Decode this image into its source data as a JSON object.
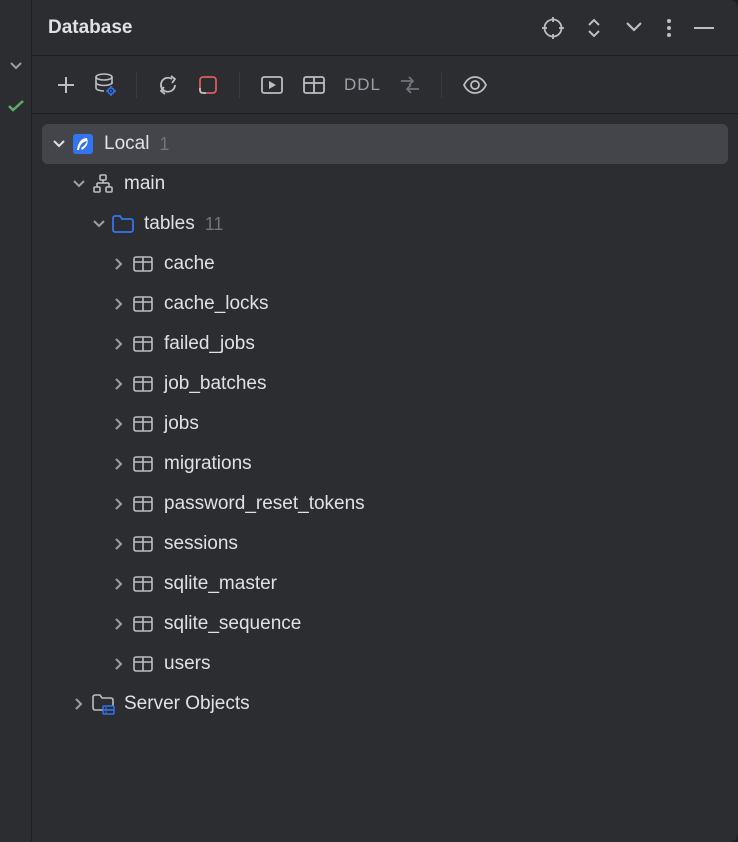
{
  "panel": {
    "title": "Database"
  },
  "toolbar": {
    "ddl_label": "DDL"
  },
  "tree": {
    "connection": {
      "label": "Local",
      "count": "1"
    },
    "schema": {
      "label": "main"
    },
    "tables_folder": {
      "label": "tables",
      "count": "11"
    },
    "tables": [
      {
        "name": "cache"
      },
      {
        "name": "cache_locks"
      },
      {
        "name": "failed_jobs"
      },
      {
        "name": "job_batches"
      },
      {
        "name": "jobs"
      },
      {
        "name": "migrations"
      },
      {
        "name": "password_reset_tokens"
      },
      {
        "name": "sessions"
      },
      {
        "name": "sqlite_master"
      },
      {
        "name": "sqlite_sequence"
      },
      {
        "name": "users"
      }
    ],
    "server_objects": {
      "label": "Server Objects"
    }
  },
  "colors": {
    "feather_blue": "#3574f0",
    "folder_blue": "#3574f0",
    "server_blue": "#3574f0",
    "red_accent": "#db5c5c",
    "gear_blue": "#3574f0",
    "check_green": "#5fad65"
  }
}
